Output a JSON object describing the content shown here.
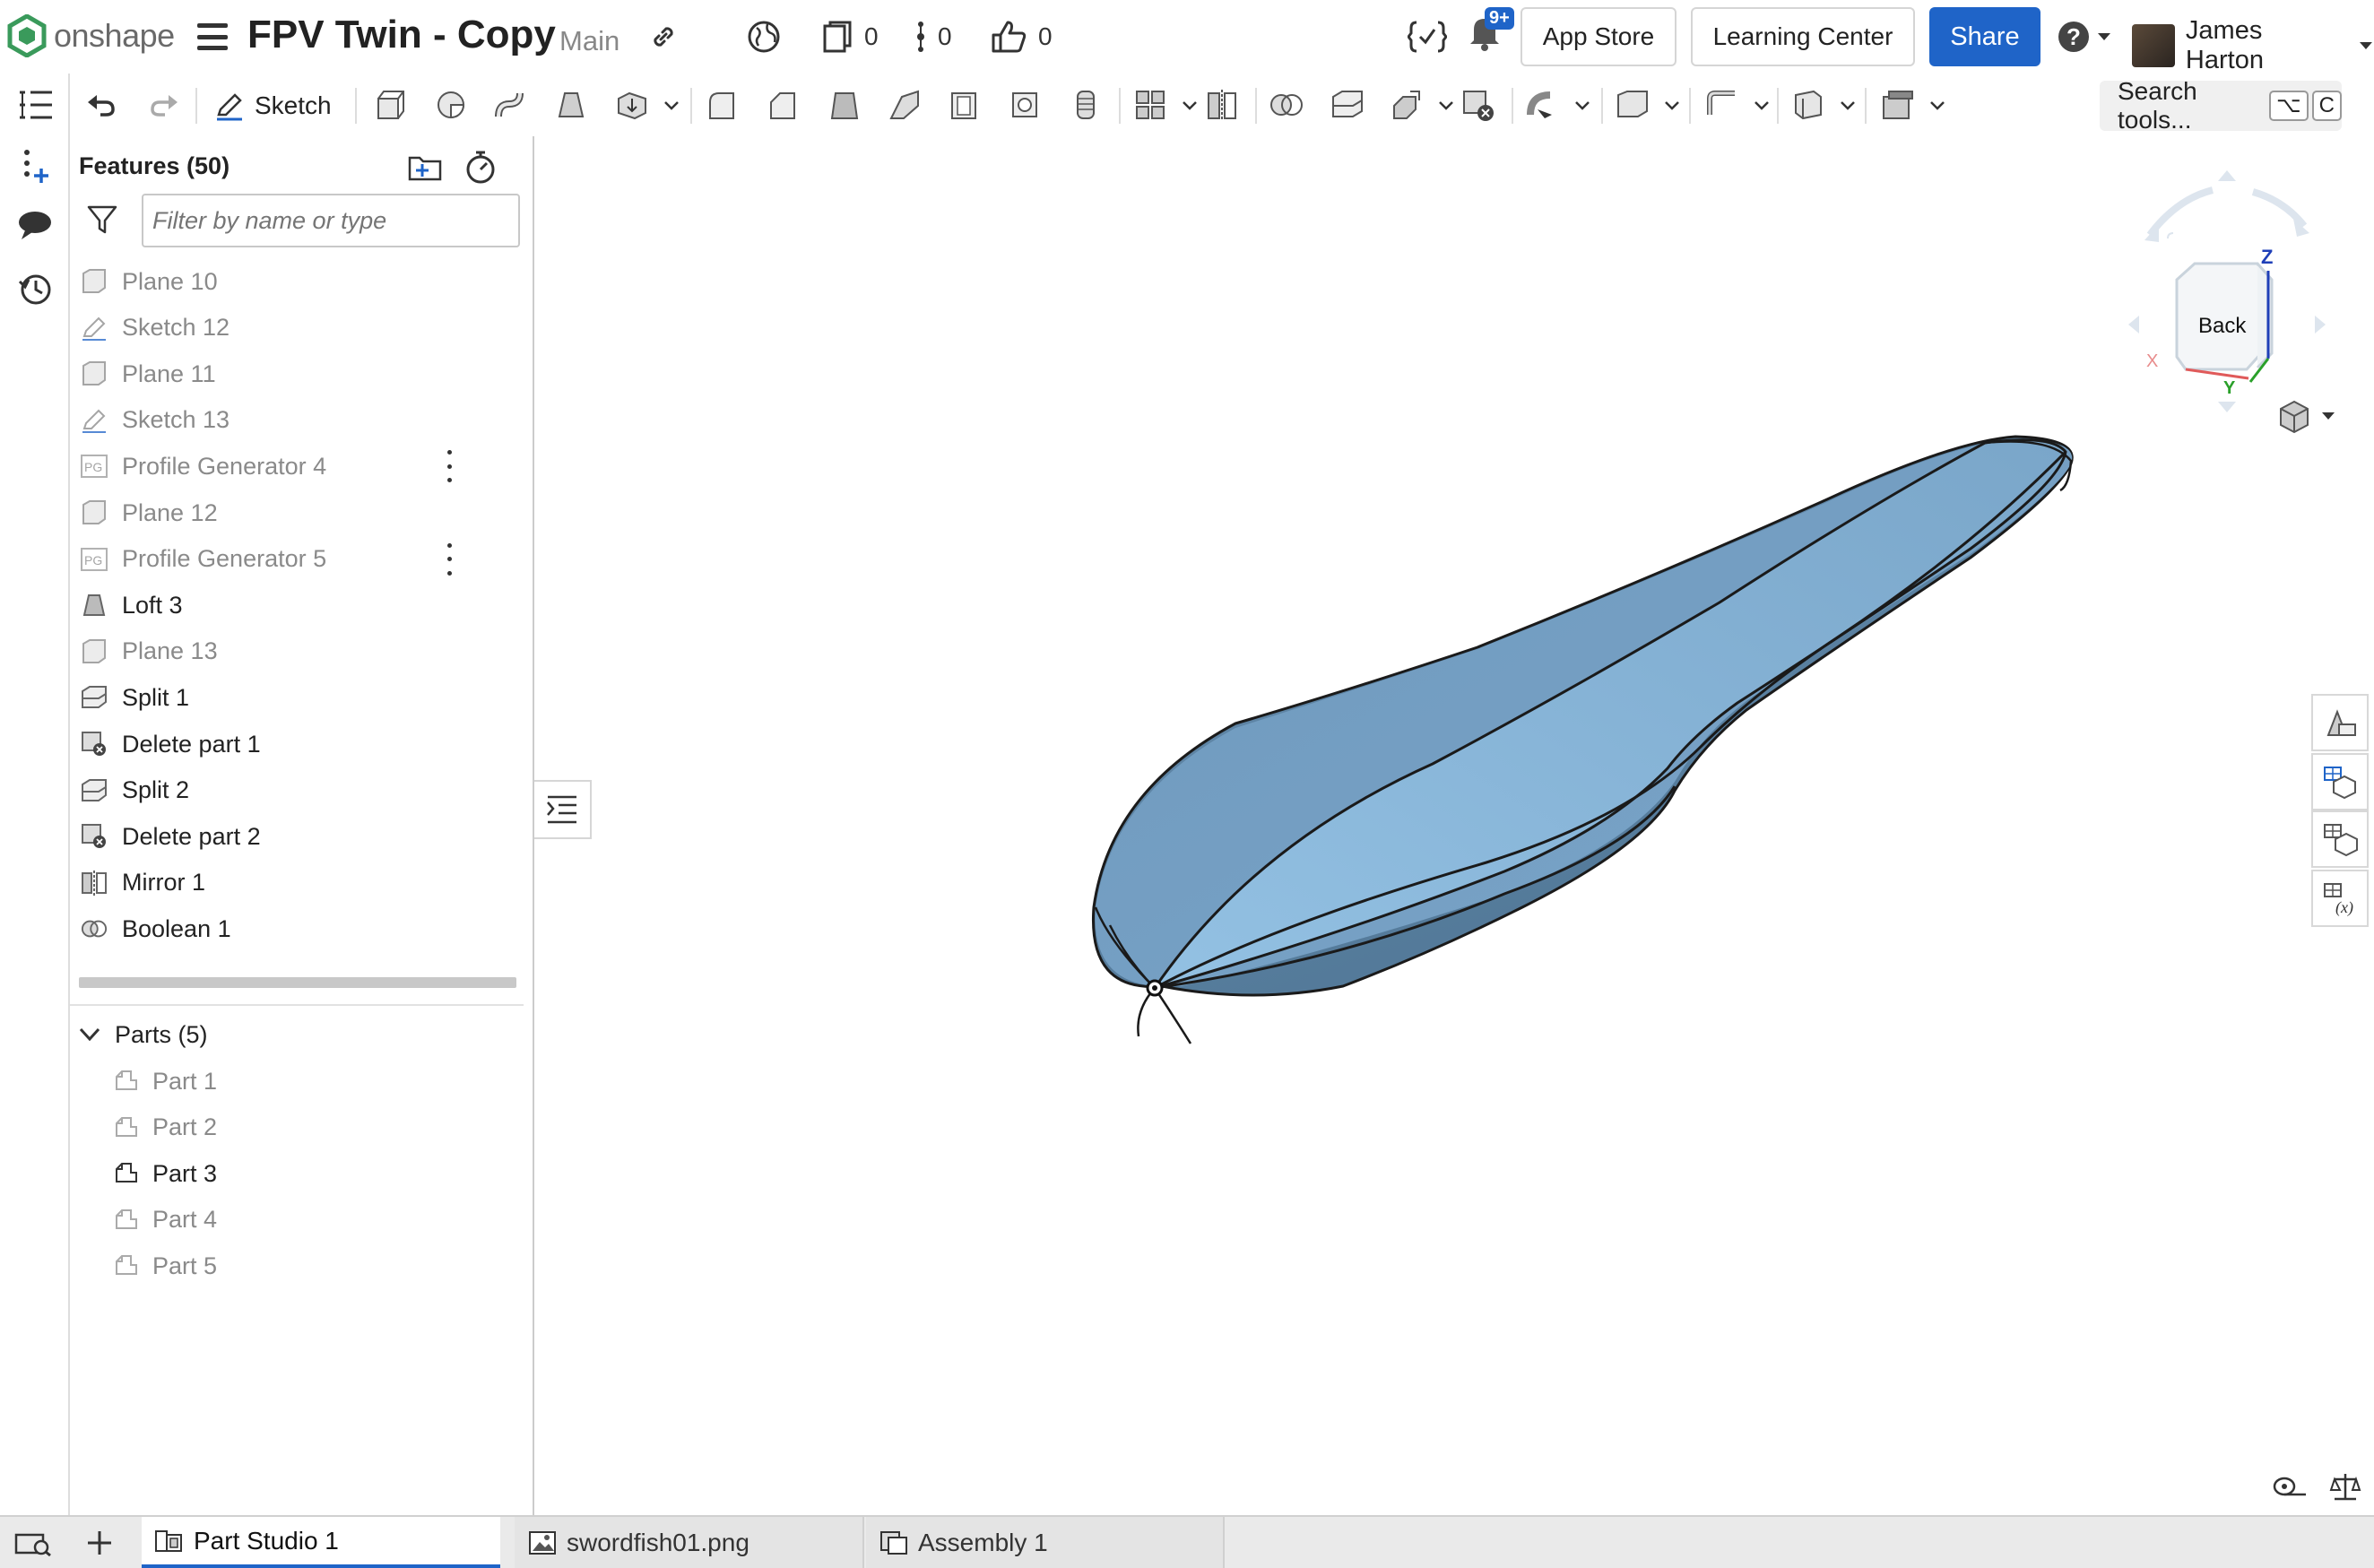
{
  "header": {
    "logo_text": "onshape",
    "doc_title": "FPV Twin - Copy",
    "branch": "Main",
    "versions_count": "0",
    "branches_count": "0",
    "likes_count": "0",
    "notifications_badge": "9+",
    "app_store_label": "App Store",
    "learning_center_label": "Learning Center",
    "share_label": "Share",
    "help_icon": "?",
    "user_name": "James Harton"
  },
  "toolbar": {
    "sketch_label": "Sketch",
    "search_label": "Search tools...",
    "search_shortcut_1": "⌥",
    "search_shortcut_2": "C"
  },
  "features_panel": {
    "title": "Features (50)",
    "filter_placeholder": "Filter by name or type",
    "features": [
      {
        "label": "Plane 10",
        "icon": "plane-icon",
        "state": "suppressed"
      },
      {
        "label": "Sketch 12",
        "icon": "sketch-icon",
        "state": "suppressed"
      },
      {
        "label": "Plane 11",
        "icon": "plane-icon",
        "state": "suppressed"
      },
      {
        "label": "Sketch 13",
        "icon": "sketch-icon",
        "state": "suppressed"
      },
      {
        "label": "Profile Generator 4",
        "icon": "profile-generator-icon",
        "icon_text": "PG",
        "state": "suppressed",
        "has_menu": true
      },
      {
        "label": "Plane 12",
        "icon": "plane-icon",
        "state": "suppressed"
      },
      {
        "label": "Profile Generator 5",
        "icon": "profile-generator-icon",
        "icon_text": "PG",
        "state": "suppressed",
        "has_menu": true
      },
      {
        "label": "Loft 3",
        "icon": "loft-icon",
        "state": "active"
      },
      {
        "label": "Plane 13",
        "icon": "plane-icon",
        "state": "suppressed"
      },
      {
        "label": "Split 1",
        "icon": "split-icon",
        "state": "active"
      },
      {
        "label": "Delete part 1",
        "icon": "delete-part-icon",
        "state": "active"
      },
      {
        "label": "Split 2",
        "icon": "split-icon",
        "state": "active"
      },
      {
        "label": "Delete part 2",
        "icon": "delete-part-icon",
        "state": "active"
      },
      {
        "label": "Mirror 1",
        "icon": "mirror-icon",
        "state": "active"
      },
      {
        "label": "Boolean 1",
        "icon": "boolean-icon",
        "state": "active"
      }
    ],
    "parts_header": "Parts (5)",
    "parts": [
      {
        "label": "Part 1",
        "state": "hidden"
      },
      {
        "label": "Part 2",
        "state": "hidden"
      },
      {
        "label": "Part 3",
        "state": "visible"
      },
      {
        "label": "Part 4",
        "state": "hidden"
      },
      {
        "label": "Part 5",
        "state": "hidden"
      }
    ]
  },
  "view_cube": {
    "face_label": "Back",
    "axis_z": "Z",
    "axis_y": "Y",
    "axis_x": "X"
  },
  "tabs": [
    {
      "label": "Part Studio 1",
      "icon": "part-studio-icon",
      "active": true
    },
    {
      "label": "swordfish01.png",
      "icon": "image-icon",
      "active": false
    },
    {
      "label": "Assembly 1",
      "icon": "assembly-icon",
      "active": false
    }
  ],
  "colors": {
    "accent": "#1f64c8",
    "part_fill": "#8ab5d6",
    "part_shadow": "#5d84a4"
  }
}
